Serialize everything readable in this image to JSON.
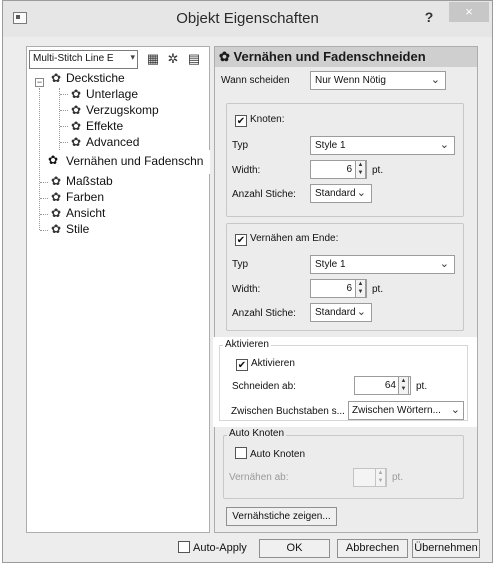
{
  "window": {
    "title": "Objekt Eigenschaften",
    "help": "?",
    "close": "×"
  },
  "left": {
    "combo": "Multi-Stitch Line E",
    "tree": [
      "Deckstiche",
      "Unterlage",
      "Verzugskomp",
      "Effekte",
      "Advanced",
      "Vernähen und Fadenschn",
      "Maßstab",
      "Farben",
      "Ansicht",
      "Stile"
    ]
  },
  "right": {
    "header": "Vernähen und Fadenschneiden",
    "wann_label": "Wann scheiden",
    "wann_value": "Nur Wenn Nötig",
    "knoten": {
      "title": "Knoten:",
      "typ_label": "Typ",
      "typ_value": "Style 1",
      "width_label": "Width:",
      "width_value": "6",
      "width_unit": "pt.",
      "anzahl_label": "Anzahl Stiche:",
      "anzahl_value": "Standard"
    },
    "ende": {
      "title": "Vernähen am Ende:",
      "typ_label": "Typ",
      "typ_value": "Style 1",
      "width_label": "Width:",
      "width_value": "6",
      "width_unit": "pt.",
      "anzahl_label": "Anzahl Stiche:",
      "anzahl_value": "Standard"
    },
    "aktivieren": {
      "group": "Aktivieren",
      "check": "Aktivieren",
      "schneiden_label": "Schneiden ab:",
      "schneiden_value": "64",
      "schneiden_unit": "pt.",
      "zwischen_label": "Zwischen Buchstaben s...",
      "zwischen_value": "Zwischen Wörtern..."
    },
    "auto": {
      "group": "Auto Knoten",
      "check": "Auto Knoten",
      "vern_label": "Vernähen ab:",
      "vern_unit": "pt."
    },
    "show_button": "Vernähstiche zeigen..."
  },
  "footer": {
    "auto_apply": "Auto-Apply",
    "ok": "OK",
    "cancel": "Abbrechen",
    "apply": "Übernehmen"
  }
}
